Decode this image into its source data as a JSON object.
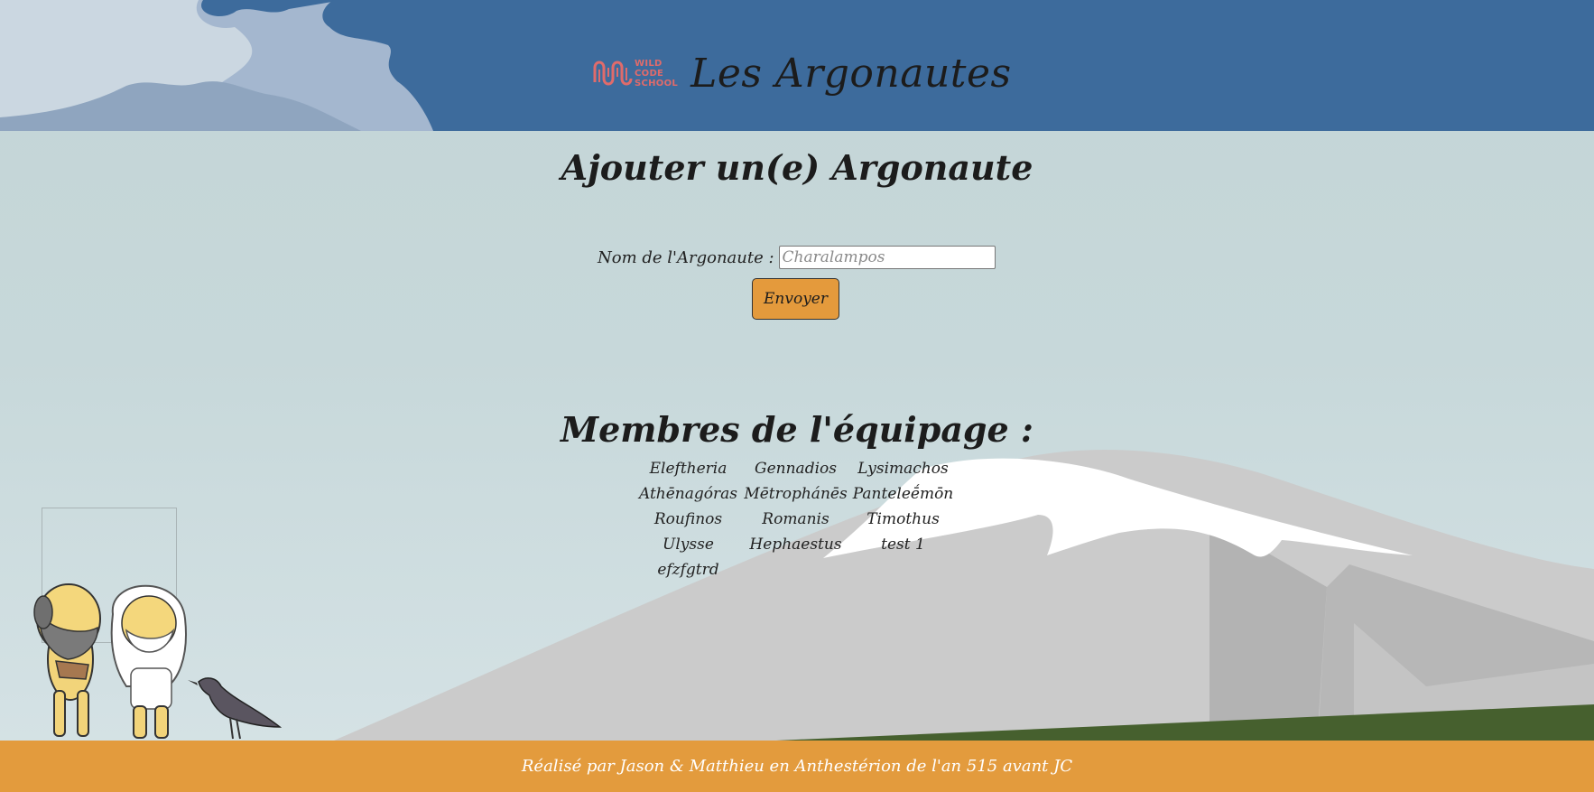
{
  "header": {
    "logo_lines": [
      "WILD",
      "CODE",
      "SCHOOL"
    ],
    "site_title": "Les Argonautes"
  },
  "form": {
    "title": "Ajouter un(e) Argonaute",
    "label": "Nom de l'Argonaute :",
    "input_placeholder": "Charalampos",
    "input_value": "",
    "submit_label": "Envoyer"
  },
  "crew": {
    "title": "Membres de l'équipage :",
    "members": [
      "Eleftheria",
      "Gennadios",
      "Lysimachos",
      "Athēnagóras",
      "Mētrophánēs",
      "Panteleḗmōn",
      "Roufinos",
      "Romanis",
      "Timothus",
      "Ulysse",
      "Hephaestus",
      "test 1",
      "efzfgtrd"
    ]
  },
  "footer": {
    "text": "Réalisé par Jason & Matthieu en Anthestérion de l'an 515 avant JC"
  },
  "colors": {
    "header_bg": "#3d6b9c",
    "button_bg": "#e49a3c",
    "footer_bg": "#e39b3d",
    "logo": "#e06b6b"
  }
}
